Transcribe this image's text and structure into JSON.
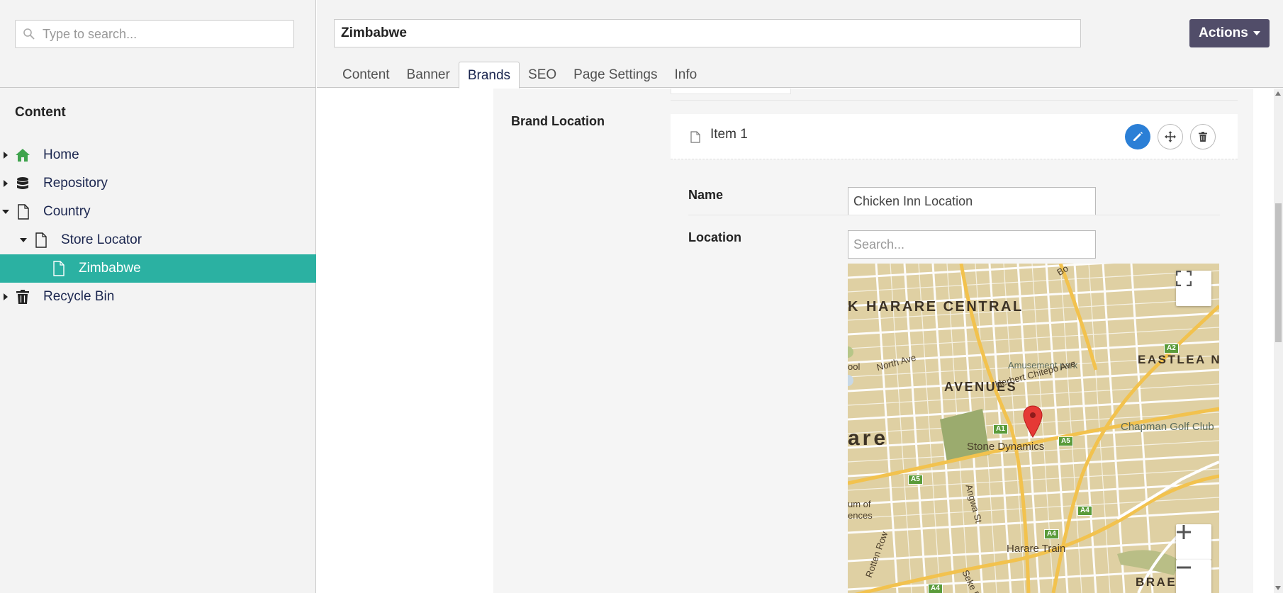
{
  "sidebar": {
    "search_placeholder": "Type to search...",
    "tree_title": "Content",
    "items": [
      {
        "label": "Home",
        "icon": "home-icon"
      },
      {
        "label": "Repository",
        "icon": "database-icon"
      },
      {
        "label": "Country",
        "icon": "document-icon"
      },
      {
        "label": "Store Locator",
        "icon": "document-icon"
      },
      {
        "label": "Zimbabwe",
        "icon": "document-icon"
      },
      {
        "label": "Recycle Bin",
        "icon": "trash-icon"
      }
    ]
  },
  "header": {
    "title": "Zimbabwe",
    "actions_label": "Actions",
    "tabs": [
      {
        "label": "Content"
      },
      {
        "label": "Banner"
      },
      {
        "label": "Brands"
      },
      {
        "label": "SEO"
      },
      {
        "label": "Page Settings"
      },
      {
        "label": "Info"
      }
    ],
    "active_tab": "Brands"
  },
  "editor": {
    "brand_location_label": "Brand Location",
    "item_label": "Item 1",
    "name_label": "Name",
    "name_value": "Chicken Inn Location",
    "location_label": "Location",
    "location_placeholder": "Search..."
  },
  "map": {
    "labels": {
      "harare_central": "HARARE CENTRAL",
      "k_fragment": "K",
      "avenues": "AVENUES",
      "eastlea": "EASTLEA N",
      "are": "are",
      "braesi": "BRAESI",
      "north_ave": "North Ave",
      "herbert": "Herbert Chitepo Ave",
      "amusement": "Amusement park",
      "chapman": "Chapman Golf Club",
      "stone": "Stone Dynamics",
      "angwa": "Angwa St",
      "harare_train": "Harare Train",
      "rotten_row": "Rotten Row",
      "seke": "Seke R",
      "um_of": "um of",
      "ences": "ences",
      "ool": "ool",
      "bo": "Bo"
    },
    "shields": [
      "A1",
      "A5",
      "A5",
      "A4",
      "A4",
      "A2",
      "A4"
    ],
    "colors": {
      "land": "#dfd0a3",
      "road": "#ffffff",
      "major_road": "#f2c24e",
      "park": "#9bab6e",
      "pin": "#e53935"
    }
  },
  "colors": {
    "active_tree": "#2bb1a2",
    "actions_bg": "#514d69",
    "edit_button": "#2b7fd6"
  }
}
